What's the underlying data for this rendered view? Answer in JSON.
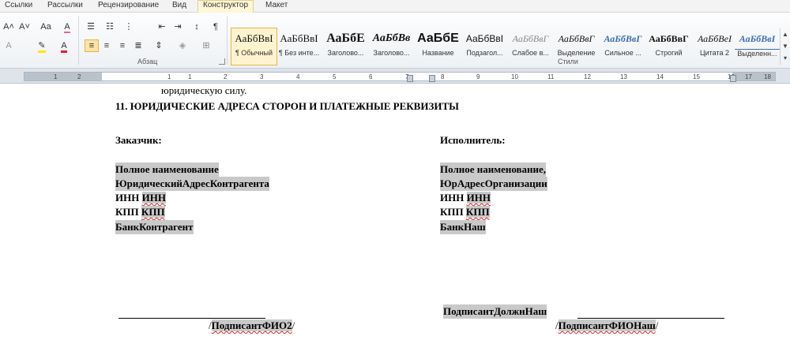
{
  "tabs": [
    "Ссылки",
    "Рассылки",
    "Рецензирование",
    "Вид",
    "Конструктор",
    "Макет"
  ],
  "ribbon": {
    "group_paragraph": "Абзац",
    "group_styles": "Стили",
    "font_grow": "A˄",
    "font_shrink": "A˅",
    "change_case": "Aa",
    "clear_format": "A",
    "pilcrow": "¶",
    "styles": [
      {
        "preview": "АаБбВвІ",
        "name": "¶ Обычный"
      },
      {
        "preview": "АаБбВвІ",
        "name": "¶ Без инте..."
      },
      {
        "preview": "АаБбЕ",
        "name": "Заголово..."
      },
      {
        "preview": "АаБбВв",
        "name": "Заголово..."
      },
      {
        "preview": "АаБбЕ",
        "name": "Название"
      },
      {
        "preview": "АаБбВвІ",
        "name": "Подзагол..."
      },
      {
        "preview": "АаБбВвГ",
        "name": "Слабое в..."
      },
      {
        "preview": "АаБбВвГ",
        "name": "Выделение"
      },
      {
        "preview": "АаБбВвГ",
        "name": "Сильное ..."
      },
      {
        "preview": "АаБбВвГ",
        "name": "Строгий"
      },
      {
        "preview": "АаБбВеІ",
        "name": "Цитата 2"
      },
      {
        "preview": "АаБбВвІ",
        "name": "Выделенн..."
      }
    ]
  },
  "ruler": {
    "ticks": [
      "1",
      "2",
      "1",
      "1",
      "2",
      "3",
      "4",
      "5",
      "6",
      "7",
      "8",
      "9",
      "10",
      "11",
      "12",
      "13",
      "14",
      "15",
      "16",
      "17",
      "18"
    ]
  },
  "document": {
    "top_line": "юридическую силу.",
    "section_heading": "11. ЮРИДИЧЕСКИЕ АДРЕСА СТОРОН И ПЛАТЕЖНЫЕ РЕКВИЗИТЫ",
    "customer": {
      "label": "Заказчик:",
      "name": "Полное наименование",
      "address": "ЮридическийАдресКонтрагента",
      "inn_label": "ИНН",
      "inn_value": "ИНН",
      "kpp_label": "КПП",
      "kpp_value": "КПП",
      "bank": "БанкКонтрагент",
      "signer_fio": "ПодписантФИО2",
      "slash_open": "/",
      "slash_close": "/"
    },
    "contractor": {
      "label": "Исполнитель:",
      "name": "Полное наименование,",
      "address": "ЮрАдресОрганизации",
      "inn_label": "ИНН",
      "inn_value": "ИНН",
      "kpp_label": "КПП",
      "kpp_value": "КПП",
      "bank": "БанкНаш",
      "signer_position": "ПодписантДолжнНаш",
      "signer_fio": "ПодписантФИОНаш",
      "slash_open": "/",
      "slash_close": "/"
    }
  },
  "colors": {
    "field_shading": "#c9c9c9",
    "spell_underline": "#d22222",
    "ribbon_selection": "#fbe3a4"
  }
}
